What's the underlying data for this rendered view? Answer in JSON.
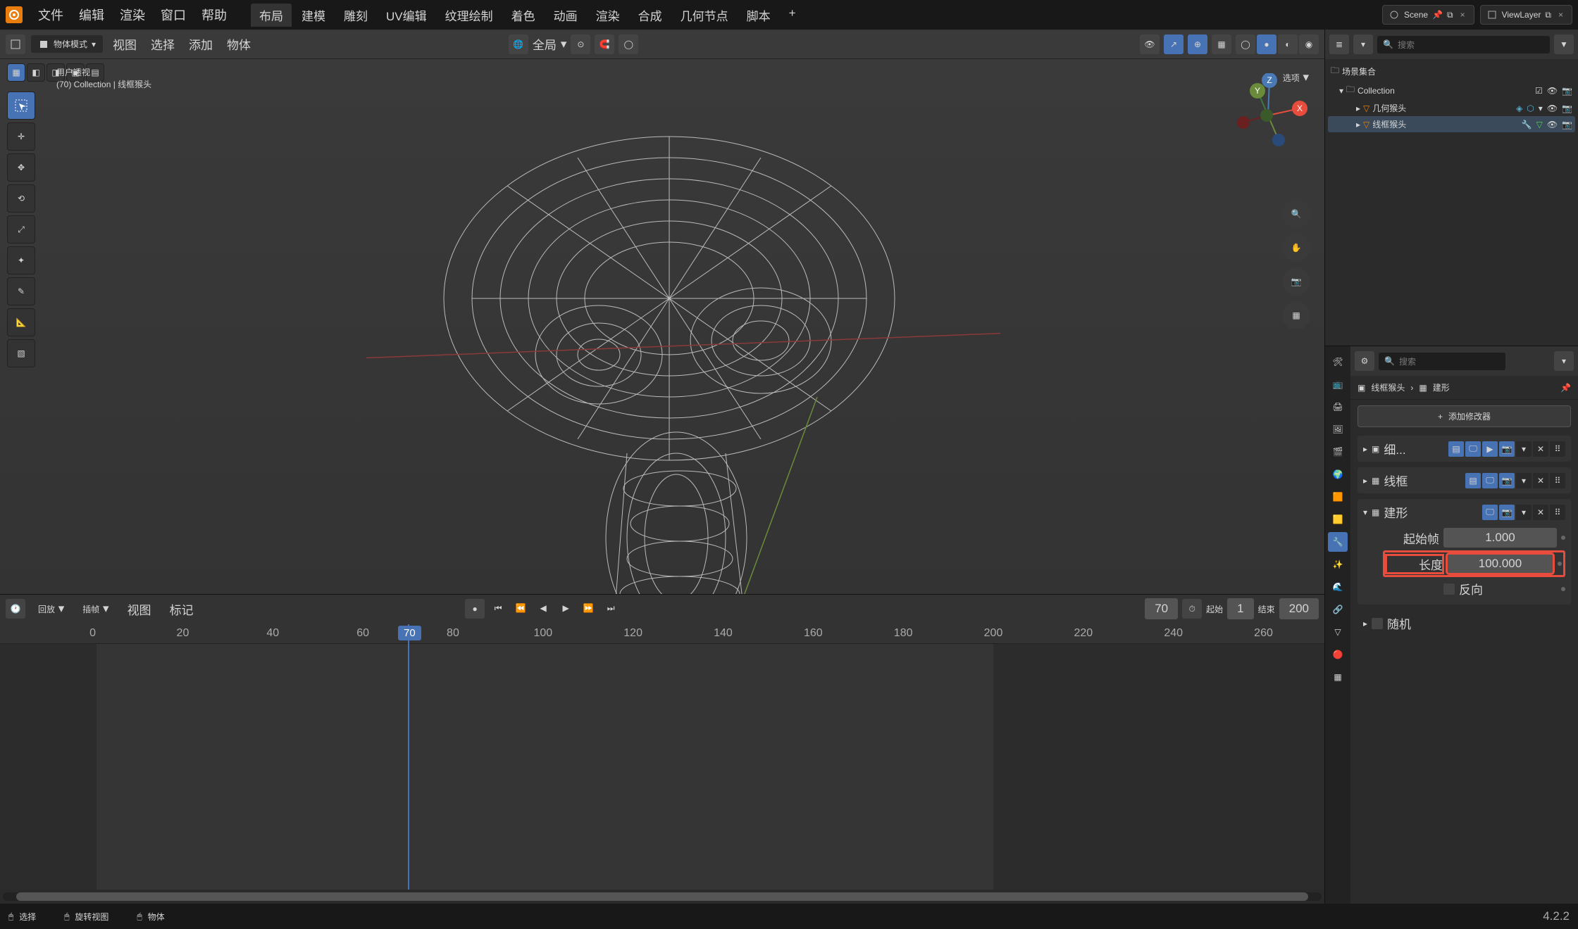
{
  "top": {
    "menus": [
      "文件",
      "编辑",
      "渲染",
      "窗口",
      "帮助"
    ],
    "tabs": [
      "布局",
      "建模",
      "雕刻",
      "UV编辑",
      "纹理绘制",
      "着色",
      "动画",
      "渲染",
      "合成",
      "几何节点",
      "脚本"
    ],
    "active_tab": 0,
    "scene_label": "Scene",
    "layer_label": "ViewLayer"
  },
  "viewport": {
    "mode": "物体模式",
    "menus": [
      "视图",
      "选择",
      "添加",
      "物体"
    ],
    "orient_label": "全局",
    "options_label": "选项",
    "overlay_title": "用户透视",
    "overlay_sub": "(70) Collection | 线框猴头",
    "axes": {
      "x": "X",
      "y": "Y",
      "z": "Z"
    }
  },
  "outliner": {
    "search_ph": "搜索",
    "root": "场景集合",
    "items": [
      {
        "name": "Collection",
        "children": [
          {
            "name": "几何猴头"
          },
          {
            "name": "线框猴头",
            "active": true
          }
        ]
      }
    ]
  },
  "props": {
    "search_ph": "搜索",
    "breadcrumb_obj": "线框猴头",
    "breadcrumb_mod": "建形",
    "add_modifier": "添加修改器",
    "modifiers": [
      {
        "name": "细...",
        "type": "subdiv"
      },
      {
        "name": "线框",
        "type": "wire"
      },
      {
        "name": "建形",
        "type": "build",
        "expanded": true
      }
    ],
    "build": {
      "start_label": "起始帧",
      "start_val": "1.000",
      "len_label": "长度",
      "len_val": "100.000",
      "reverse_label": "反向",
      "random_label": "随机"
    }
  },
  "timeline": {
    "menus": [
      "回放",
      "插帧",
      "视图",
      "标记"
    ],
    "frame": "70",
    "start_label": "起始",
    "start": "1",
    "end_label": "结束",
    "end": "200",
    "ticks": [
      0,
      20,
      40,
      60,
      80,
      100,
      120,
      140,
      160,
      180,
      200,
      220,
      240,
      260
    ]
  },
  "status": {
    "select": "选择",
    "rotate": "旋转视图",
    "object": "物体",
    "version": "4.2.2"
  }
}
